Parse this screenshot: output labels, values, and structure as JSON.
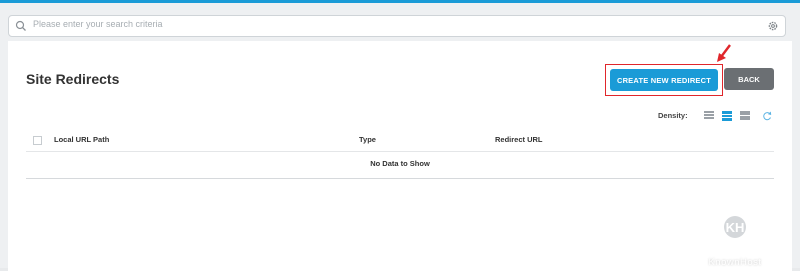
{
  "search": {
    "placeholder": "Please enter your search criteria",
    "search_icon": "search-icon",
    "settings_icon": "gear-icon"
  },
  "page": {
    "title": "Site Redirects"
  },
  "buttons": {
    "create": "CREATE NEW REDIRECT",
    "back": "BACK"
  },
  "density": {
    "label": "Density:",
    "options": [
      "compact",
      "standard",
      "comfortable"
    ],
    "selected": "standard",
    "refresh_icon": "refresh-icon"
  },
  "table": {
    "columns": [
      "Local URL Path",
      "Type",
      "Redirect URL"
    ],
    "empty_message": "No Data to Show"
  },
  "watermark": {
    "brand": "KnownHost"
  },
  "colors": {
    "accent": "#1a9bd7",
    "highlight": "#e0262b",
    "back_button": "#6b6f73"
  }
}
